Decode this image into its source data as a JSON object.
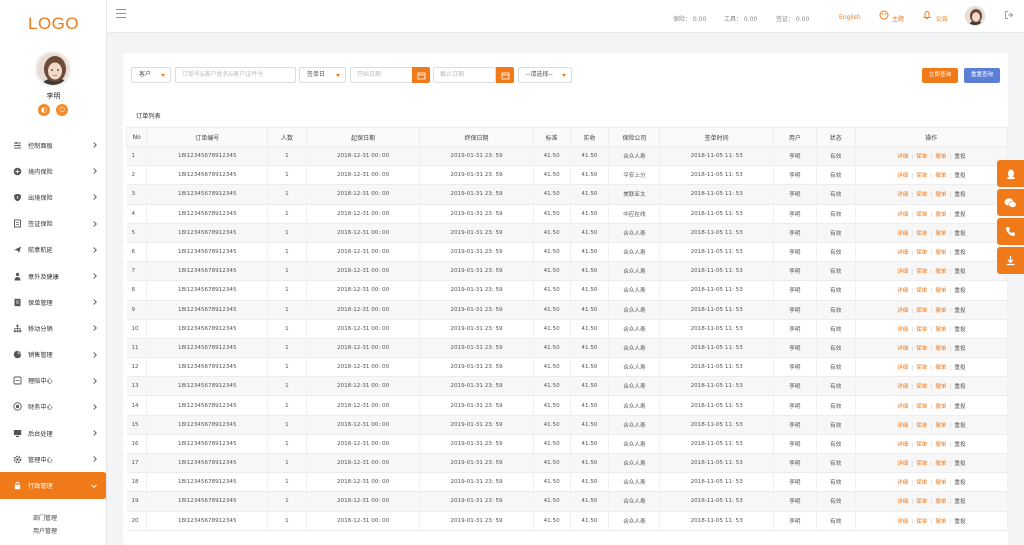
{
  "sidebar": {
    "logo": "LOGO",
    "user_name": "李明",
    "user_btn_1": "◐",
    "user_btn_2": "⏻",
    "items": [
      {
        "label": "控制面板",
        "icon": "sliders-icon"
      },
      {
        "label": "境内保险",
        "icon": "shield-plus-icon"
      },
      {
        "label": "出境保险",
        "icon": "shield-icon"
      },
      {
        "label": "签证保险",
        "icon": "document-icon"
      },
      {
        "label": "航意航延",
        "icon": "airplane-icon"
      },
      {
        "label": "意外及健康",
        "icon": "person-icon"
      },
      {
        "label": "保单管理",
        "icon": "file-icon"
      },
      {
        "label": "移动分销",
        "icon": "network-icon"
      },
      {
        "label": "销售管理",
        "icon": "pie-icon"
      },
      {
        "label": "理赔中心",
        "icon": "receipt-icon"
      },
      {
        "label": "财务中心",
        "icon": "coin-icon"
      },
      {
        "label": "后台处理",
        "icon": "monitor-icon"
      },
      {
        "label": "管理中心",
        "icon": "gear-icon"
      },
      {
        "label": "行政管理",
        "icon": "lock-icon"
      }
    ],
    "submenu": [
      "部门管理",
      "用户管理"
    ]
  },
  "topbar": {
    "stat_1": "保险： 0.00",
    "stat_2": "工具： 0.00",
    "stat_3": "签证： 0.00",
    "lang": "English",
    "theme": "主题",
    "notice": "公告"
  },
  "filters": {
    "customer_select": "客户",
    "keyword_placeholder": "订单号&客户姓名&客户证件号",
    "date_type": "签单日",
    "start_placeholder": "开始日期",
    "end_placeholder": "截止日期",
    "choose": "--请选择--",
    "query_button": "立即查询",
    "reset_button": "重置查询"
  },
  "list_title": "订单列表",
  "columns": [
    "No",
    "订单编号",
    "人数",
    "起保日期",
    "终保日期",
    "标准",
    "实收",
    "保险公司",
    "签单时间",
    "用户",
    "状态",
    "操作"
  ],
  "actions": [
    "详细",
    "保单",
    "撤单",
    "重投"
  ],
  "rows": [
    {
      "no": "1",
      "order": "18I12345678912345",
      "count": "1",
      "start": "2018-12-31 00: 00",
      "end": "2019-01-31 23: 59",
      "std": "41.50",
      "paid": "41.50",
      "company": "合众人寿",
      "time": "2018-11-05 11: 53",
      "user": "李明",
      "status": "有效"
    },
    {
      "no": "2",
      "order": "18I12345678912345",
      "count": "1",
      "start": "2018-12-31 00: 00",
      "end": "2019-01-31 23: 59",
      "std": "41.50",
      "paid": "41.50",
      "company": "平安上分",
      "time": "2018-11-05 11: 53",
      "user": "李明",
      "status": "有效"
    },
    {
      "no": "3",
      "order": "18I12345678912345",
      "count": "1",
      "start": "2018-12-31 00: 00",
      "end": "2019-01-31 23: 59",
      "std": "41.50",
      "paid": "41.50",
      "company": "美联亚太",
      "time": "2018-11-05 11: 53",
      "user": "李明",
      "status": "有效"
    },
    {
      "no": "4",
      "order": "18I12345678912345",
      "count": "1",
      "start": "2018-12-31 00: 00",
      "end": "2019-01-31 23: 59",
      "std": "41.50",
      "paid": "41.50",
      "company": "中应在线",
      "time": "2018-11-05 11: 53",
      "user": "李明",
      "status": "有效"
    },
    {
      "no": "5",
      "order": "18I12345678912345",
      "count": "1",
      "start": "2018-12-31 00: 00",
      "end": "2019-01-31 23: 59",
      "std": "41.50",
      "paid": "41.50",
      "company": "合众人寿",
      "time": "2018-11-05 11: 53",
      "user": "李明",
      "status": "有效"
    },
    {
      "no": "6",
      "order": "18I12345678912345",
      "count": "1",
      "start": "2018-12-31 00: 00",
      "end": "2019-01-31 23: 59",
      "std": "41.50",
      "paid": "41.50",
      "company": "合众人寿",
      "time": "2018-11-05 11: 53",
      "user": "李明",
      "status": "有效"
    },
    {
      "no": "7",
      "order": "18I12345678912345",
      "count": "1",
      "start": "2018-12-31 00: 00",
      "end": "2019-01-31 23: 59",
      "std": "41.50",
      "paid": "41.50",
      "company": "合众人寿",
      "time": "2018-11-05 11: 53",
      "user": "李明",
      "status": "有效"
    },
    {
      "no": "8",
      "order": "18I12345678912345",
      "count": "1",
      "start": "2018-12-31 00: 00",
      "end": "2019-01-31 23: 59",
      "std": "41.50",
      "paid": "41.50",
      "company": "合众人寿",
      "time": "2018-11-05 11: 53",
      "user": "李明",
      "status": "有效"
    },
    {
      "no": "9",
      "order": "18I12345678912345",
      "count": "1",
      "start": "2018-12-31 00: 00",
      "end": "2019-01-31 23: 59",
      "std": "41.50",
      "paid": "41.50",
      "company": "合众人寿",
      "time": "2018-11-05 11: 53",
      "user": "李明",
      "status": "有效"
    },
    {
      "no": "10",
      "order": "18I12345678912345",
      "count": "1",
      "start": "2018-12-31 00: 00",
      "end": "2019-01-31 23: 59",
      "std": "41.50",
      "paid": "41.50",
      "company": "合众人寿",
      "time": "2018-11-05 11: 53",
      "user": "李明",
      "status": "有效"
    },
    {
      "no": "11",
      "order": "18I12345678912345",
      "count": "1",
      "start": "2018-12-31 00: 00",
      "end": "2019-01-31 23: 59",
      "std": "41.50",
      "paid": "41.50",
      "company": "合众人寿",
      "time": "2018-11-05 11: 53",
      "user": "李明",
      "status": "有效"
    },
    {
      "no": "12",
      "order": "18I12345678912345",
      "count": "1",
      "start": "2018-12-31 00: 00",
      "end": "2019-01-31 23: 59",
      "std": "41.50",
      "paid": "41.50",
      "company": "合众人寿",
      "time": "2018-11-05 11: 53",
      "user": "李明",
      "status": "有效"
    },
    {
      "no": "13",
      "order": "18I12345678912345",
      "count": "1",
      "start": "2018-12-31 00: 00",
      "end": "2019-01-31 23: 59",
      "std": "41.50",
      "paid": "41.50",
      "company": "合众人寿",
      "time": "2018-11-05 11: 53",
      "user": "李明",
      "status": "有效"
    },
    {
      "no": "14",
      "order": "18I12345678912345",
      "count": "1",
      "start": "2018-12-31 00: 00",
      "end": "2019-01-31 23: 59",
      "std": "41.50",
      "paid": "41.50",
      "company": "合众人寿",
      "time": "2018-11-05 11: 53",
      "user": "李明",
      "status": "有效"
    },
    {
      "no": "15",
      "order": "18I12345678912345",
      "count": "1",
      "start": "2018-12-31 00: 00",
      "end": "2019-01-31 23: 59",
      "std": "41.50",
      "paid": "41.50",
      "company": "合众人寿",
      "time": "2018-11-05 11: 53",
      "user": "李明",
      "status": "有效"
    },
    {
      "no": "16",
      "order": "18I12345678912345",
      "count": "1",
      "start": "2018-12-31 00: 00",
      "end": "2019-01-31 23: 59",
      "std": "41.50",
      "paid": "41.50",
      "company": "合众人寿",
      "time": "2018-11-05 11: 53",
      "user": "李明",
      "status": "有效"
    },
    {
      "no": "17",
      "order": "18I12345678912345",
      "count": "1",
      "start": "2018-12-31 00: 00",
      "end": "2019-01-31 23: 59",
      "std": "41.50",
      "paid": "41.50",
      "company": "合众人寿",
      "time": "2018-11-05 11: 53",
      "user": "李明",
      "status": "有效"
    },
    {
      "no": "18",
      "order": "18I12345678912345",
      "count": "1",
      "start": "2018-12-31 00: 00",
      "end": "2019-01-31 23: 59",
      "std": "41.50",
      "paid": "41.50",
      "company": "合众人寿",
      "time": "2018-11-05 11: 53",
      "user": "李明",
      "status": "有效"
    },
    {
      "no": "19",
      "order": "18I12345678912345",
      "count": "1",
      "start": "2018-12-31 00: 00",
      "end": "2019-01-31 23: 59",
      "std": "41.50",
      "paid": "41.50",
      "company": "合众人寿",
      "time": "2018-11-05 11: 53",
      "user": "李明",
      "status": "有效"
    },
    {
      "no": "20",
      "order": "18I12345678912345",
      "count": "1",
      "start": "2018-12-31 00: 00",
      "end": "2019-01-31 23: 59",
      "std": "41.50",
      "paid": "41.50",
      "company": "合众人寿",
      "time": "2018-11-05 11: 53",
      "user": "李明",
      "status": "有效"
    }
  ],
  "float_bar": [
    "qq-icon",
    "wechat-icon",
    "phone-icon",
    "download-icon"
  ],
  "colors": {
    "accent": "#f07a19",
    "reset": "#5b7fd6"
  }
}
